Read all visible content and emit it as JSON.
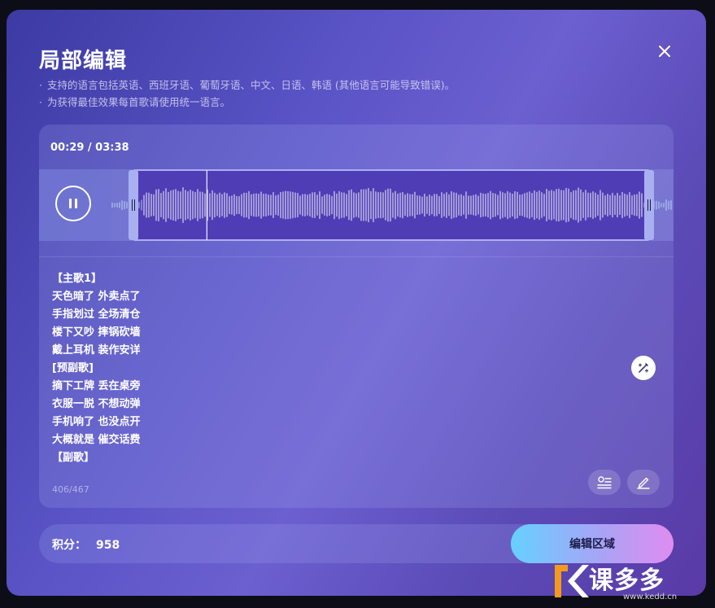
{
  "dialog": {
    "title": "局部编辑",
    "notes": [
      "支持的语言包括英语、西班牙语、葡萄牙语、中文、日语、韩语 (其他语言可能导致错误)。",
      "为获得最佳效果每首歌请使用统一语言。"
    ],
    "icons": {
      "close": "close-icon"
    }
  },
  "player": {
    "time": "00:29 / 03:38",
    "state": "playing",
    "icons": {
      "pause": "pause-icon"
    },
    "playhead_fraction": 0.133,
    "selection": {
      "start_fraction": 0.0,
      "end_fraction": 1.0
    },
    "colors": {
      "selection": "#4f3db5",
      "handle": "#a9b0f2",
      "bar": "#ffffff"
    }
  },
  "lyrics": {
    "lines": [
      "【主歌1】",
      "天色暗了 外卖点了",
      "手指划过 全场清仓",
      "楼下又吵 摔锅砍墙",
      "戴上耳机 装作安详",
      "[预副歌]",
      "摘下工牌 丢在桌旁",
      "衣服一脱 不想动弹",
      "手机响了 也没点开",
      "大概就是 催交话费",
      "【副歌】"
    ],
    "char_count": "406/467",
    "icons": {
      "magic": "magic-wand-icon",
      "format": "format-list-icon",
      "edit": "pencil-icon"
    }
  },
  "footer": {
    "points_label": "积分：",
    "points_value": "958",
    "edit_button": "编辑区域",
    "colors": {
      "button_start": "#66d0ff",
      "button_end": "#e08cf0"
    }
  },
  "watermark": {
    "brand": "课多多",
    "url": "www.kedd.cn"
  }
}
